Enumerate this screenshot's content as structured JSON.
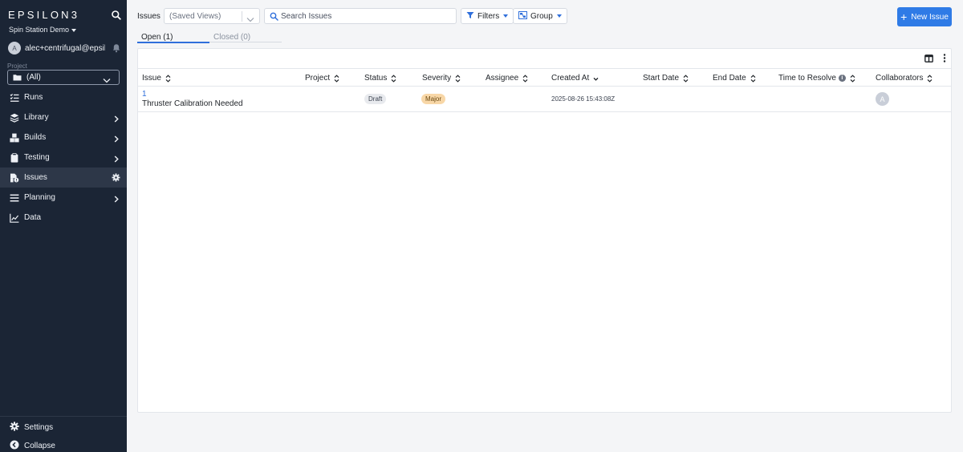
{
  "brand": "EPSILON3",
  "org": "Spin Station Demo",
  "user": {
    "avatar_letter": "A",
    "email": "alec+centrifugal@epsil..."
  },
  "project": {
    "label": "Project",
    "value": "(All)"
  },
  "nav": [
    {
      "label": "Runs",
      "icon": "runs-icon"
    },
    {
      "label": "Library",
      "icon": "library-icon"
    },
    {
      "label": "Builds",
      "icon": "builds-icon"
    },
    {
      "label": "Testing",
      "icon": "testing-icon"
    },
    {
      "label": "Issues",
      "icon": "issues-icon"
    },
    {
      "label": "Planning",
      "icon": "planning-icon"
    },
    {
      "label": "Data",
      "icon": "data-icon"
    }
  ],
  "bottom": {
    "settings": "Settings",
    "collapse": "Collapse"
  },
  "toolbar": {
    "title": "Issues",
    "saved_views": "(Saved Views)",
    "search_placeholder": "Search Issues",
    "filters": "Filters",
    "group": "Group",
    "new_issue": "New Issue"
  },
  "tabs": {
    "open": "Open (1)",
    "closed": "Closed (0)"
  },
  "table": {
    "columns": [
      "Issue",
      "Project",
      "Status",
      "Severity",
      "Assignee",
      "Created At",
      "Start Date",
      "End Date",
      "Time to Resolve",
      "Collaborators"
    ],
    "rows": [
      {
        "id": "1",
        "title": "Thruster Calibration Needed",
        "project": "",
        "status": "Draft",
        "severity": "Major",
        "assignee": "",
        "created_at": "2025-08-26 15:43:08Z",
        "start_date": "",
        "end_date": "",
        "time_to_resolve": "",
        "collaborator_letter": "A"
      }
    ]
  },
  "colors": {
    "sidebar_bg": "#1b2535",
    "accent": "#2f7be6",
    "link": "#2f6fdb",
    "major_badge": "#f8d7a7",
    "draft_badge": "#e8eaee"
  }
}
